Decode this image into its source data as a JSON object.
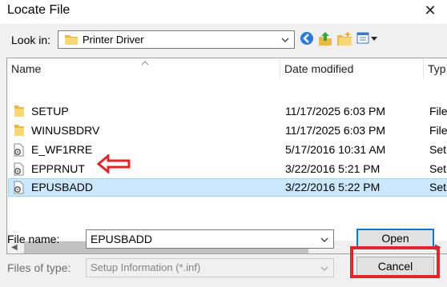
{
  "window": {
    "title": "Locate File",
    "close_glyph": "✕"
  },
  "lookin": {
    "label": "Look in:",
    "value": "Printer Driver"
  },
  "toolbar": {
    "icons": [
      "back-icon",
      "up-folder-icon",
      "new-folder-icon",
      "view-menu-icon"
    ]
  },
  "columns": {
    "name": "Name",
    "date": "Date modified",
    "type": "Typ"
  },
  "files": [
    {
      "name": "SETUP",
      "date": "11/17/2025 6:03 PM",
      "type": "File",
      "kind": "folder",
      "selected": false
    },
    {
      "name": "WINUSBDRV",
      "date": "11/17/2025 6:03 PM",
      "type": "File",
      "kind": "folder",
      "selected": false
    },
    {
      "name": "E_WF1RRE",
      "date": "5/17/2016 10:31 AM",
      "type": "Set",
      "kind": "inf",
      "selected": false
    },
    {
      "name": "EPPRNUT",
      "date": "3/22/2016 5:21 PM",
      "type": "Set",
      "kind": "inf",
      "selected": false
    },
    {
      "name": "EPUSBADD",
      "date": "3/22/2016 5:22 PM",
      "type": "Set",
      "kind": "inf",
      "selected": true
    }
  ],
  "filename": {
    "label": "File name:",
    "value": "EPUSBADD"
  },
  "filetype": {
    "label": "Files of type:",
    "value": "Setup Information (*.inf)"
  },
  "buttons": {
    "open": "Open",
    "cancel": "Cancel"
  },
  "annotation": {
    "color": "#e0262c"
  }
}
